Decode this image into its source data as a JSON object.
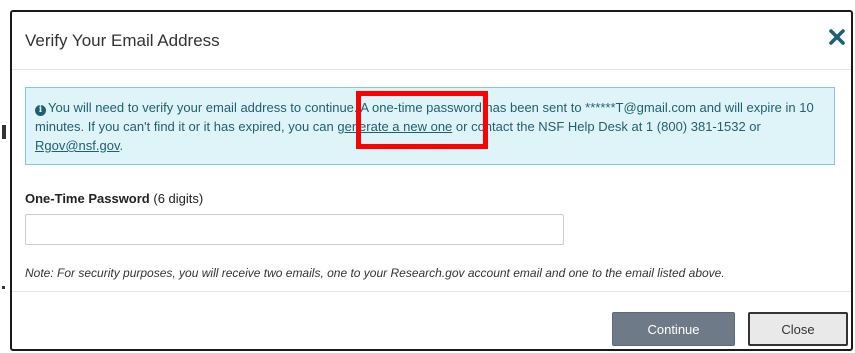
{
  "modal": {
    "title": "Verify Your Email Address",
    "close_icon": "close-icon"
  },
  "alert": {
    "icon": "info-icon",
    "text_1": "You will need to verify your email address to continue. A one-time password has been sent to ******T@gmail.com and will expire in 10 minutes. If you can't find it or it has expired, you can ",
    "link_generate": "generate a new one",
    "text_2": " or contact the NSF Help Desk at 1 (800) 381-1532 or ",
    "link_email": "Rgov@nsf.gov",
    "text_3": "."
  },
  "form": {
    "otp_label": "One-Time Password",
    "otp_hint": "(6 digits)",
    "otp_value": "",
    "otp_placeholder": ""
  },
  "note": "Note: For security purposes, you will receive two emails, one to your Research.gov account email and one to the email listed above.",
  "buttons": {
    "continue": "Continue",
    "close": "Close"
  },
  "colors": {
    "alert_bg": "#dff4f9",
    "alert_text": "#1d5f73",
    "close_x": "#1d5f73",
    "continue_bg": "#6f7a88",
    "highlight": "#ff0000"
  }
}
